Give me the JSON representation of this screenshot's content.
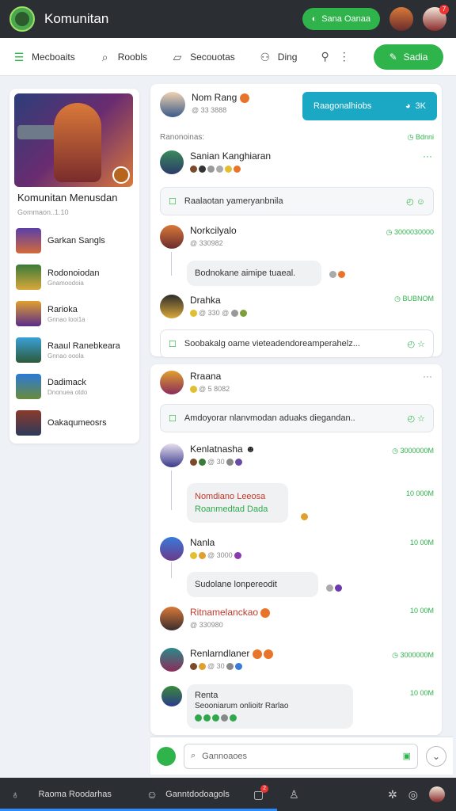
{
  "app": {
    "title": "Komunitan",
    "top_button": "Sana Oanaa",
    "notif_count": "7"
  },
  "toolbar": {
    "items": [
      {
        "label": "Mecboaits",
        "icon": "menu-icon"
      },
      {
        "label": "Roobls",
        "icon": "search-icon"
      },
      {
        "label": "Secouotas",
        "icon": "bag-icon"
      },
      {
        "label": "Ding",
        "icon": "people-icon"
      }
    ],
    "create_label": "Sadia"
  },
  "sidebar": {
    "title": "Komunitan Menusdan",
    "subtitle": "Gommaon..1.10",
    "items": [
      {
        "label": "Garkan Sangls",
        "sub": ""
      },
      {
        "label": "Rodonoiodan",
        "sub": "Gnamoodoia"
      },
      {
        "label": "Rarioka",
        "sub": "Gnnao looi1a"
      },
      {
        "label": "Raaul Ranebkeara",
        "sub": "Gnnao ooola"
      },
      {
        "label": "Dadimack",
        "sub": "Dnonuea otdo"
      },
      {
        "label": "Oakaqumeosrs",
        "sub": ""
      }
    ]
  },
  "card1": {
    "author": "Nom Rang",
    "author_meta": "@ 33 3888",
    "banner_label": "Raagonalhiobs",
    "banner_count": "3K",
    "section_label": "Ranonoinas:",
    "section_tag": "Bdnni",
    "post1": {
      "name": "Sanian Kanghiaran",
      "box": "Raalaotan yameryanbnila"
    },
    "post2": {
      "name": "Norkcilyalo",
      "meta": "@ 330982",
      "tag": "3000030000",
      "bubble": "Bodnokane aimipe tuaeal."
    },
    "post3": {
      "name": "Drahka",
      "meta": "@ 330 @",
      "tag": "BUBNOM",
      "box": "Soobakalg oame vieteadendoreamperahelz..."
    }
  },
  "card2": {
    "header": {
      "name": "Rraana",
      "meta": "@ 5 8082"
    },
    "box": "Amdoyorar nlanvmodan aduaks diegandan..",
    "c1": {
      "name": "Kenlatnasha",
      "meta": "@ 30",
      "tag": "3000000M",
      "time": "10 000M",
      "line1": "Nomdiano Leeosa",
      "line2": "Roanmedtad Dada"
    },
    "c2": {
      "name": "Nanla",
      "meta": "@ 3000",
      "time": "10 00M",
      "bubble": "Sudolane lonpereodit"
    },
    "c3": {
      "name": "Ritnamelanckao",
      "meta": "@ 330980",
      "time": "10 00M"
    },
    "c4": {
      "name": "Renlarndlaner",
      "meta": "@ 30",
      "tag": "3000000M",
      "time": "10 00M",
      "line1": "Renta",
      "line2": "Seooniarum onlioitr Rarlao"
    }
  },
  "composer": {
    "placeholder": "Gannoaoes"
  },
  "bottombar": {
    "left": "Raoma Roodarhas",
    "middle": "Ganntdodoagols",
    "badge": "2"
  }
}
